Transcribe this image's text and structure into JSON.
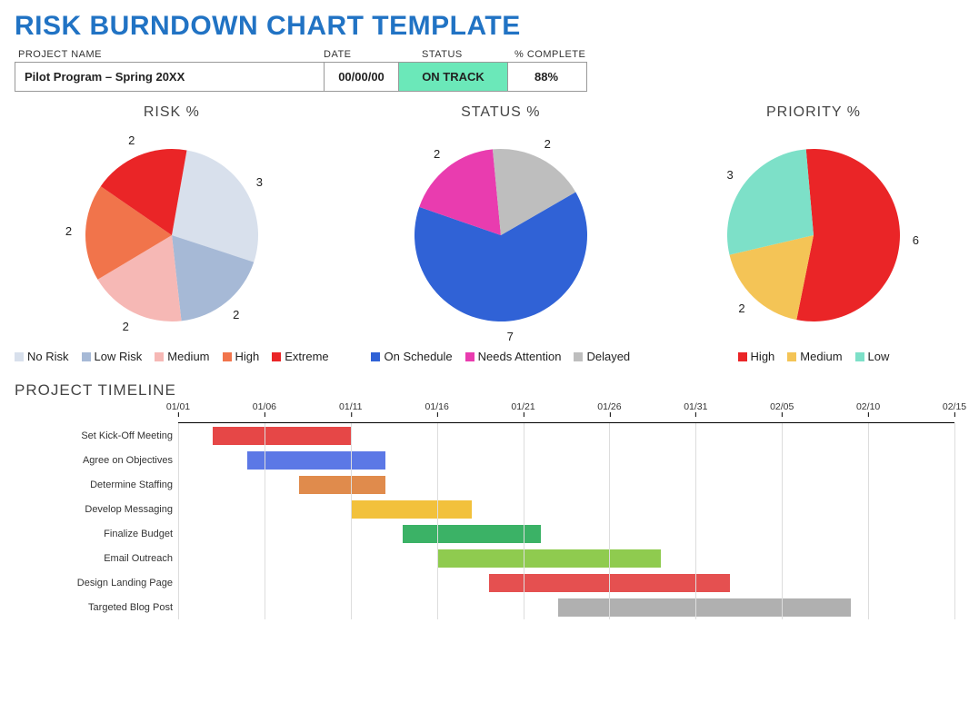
{
  "title": "RISK BURNDOWN CHART TEMPLATE",
  "meta": {
    "headers": {
      "name": "PROJECT NAME",
      "date": "DATE",
      "status": "STATUS",
      "complete": "% COMPLETE"
    },
    "name": "Pilot Program – Spring 20XX",
    "date": "00/00/00",
    "status": "ON TRACK",
    "complete": "88%",
    "status_bg": "#6BE8B9"
  },
  "charts": {
    "risk": {
      "title": "RISK %"
    },
    "status": {
      "title": "STATUS %"
    },
    "priority": {
      "title": "PRIORITY %"
    }
  },
  "legends": {
    "risk": [
      {
        "label": "No Risk",
        "color": "#D8E0EC"
      },
      {
        "label": "Low Risk",
        "color": "#A6B9D6"
      },
      {
        "label": "Medium",
        "color": "#F6B8B5"
      },
      {
        "label": "High",
        "color": "#F1744B"
      },
      {
        "label": "Extreme",
        "color": "#EA2527"
      }
    ],
    "status": [
      {
        "label": "On Schedule",
        "color": "#3062D6"
      },
      {
        "label": "Needs Attention",
        "color": "#E93CAF"
      },
      {
        "label": "Delayed",
        "color": "#BEBEBE"
      }
    ],
    "priority": [
      {
        "label": "High",
        "color": "#EA2527"
      },
      {
        "label": "Medium",
        "color": "#F4C456"
      },
      {
        "label": "Low",
        "color": "#7DE0C8"
      }
    ]
  },
  "timeline": {
    "title": "PROJECT TIMELINE",
    "ticks": [
      "01/01",
      "01/06",
      "01/11",
      "01/16",
      "01/21",
      "01/26",
      "01/31",
      "02/05",
      "02/10",
      "02/15"
    ],
    "tasks": [
      {
        "name": "Set Kick-Off Meeting",
        "start": 2,
        "dur": 8,
        "color": "#E64747"
      },
      {
        "name": "Agree on Objectives",
        "start": 4,
        "dur": 8,
        "color": "#5C78E6"
      },
      {
        "name": "Determine Staffing",
        "start": 7,
        "dur": 5,
        "color": "#E08B4C"
      },
      {
        "name": "Develop Messaging",
        "start": 10,
        "dur": 7,
        "color": "#F2C13C"
      },
      {
        "name": "Finalize Budget",
        "start": 13,
        "dur": 8,
        "color": "#3BB266"
      },
      {
        "name": "Email Outreach",
        "start": 15,
        "dur": 13,
        "color": "#8FCB4F"
      },
      {
        "name": "Design Landing Page",
        "start": 18,
        "dur": 14,
        "color": "#E55050"
      },
      {
        "name": "Targeted Blog Post",
        "start": 22,
        "dur": 17,
        "color": "#B0B0B0"
      }
    ]
  },
  "chart_data": [
    {
      "type": "pie",
      "title": "RISK %",
      "series": [
        {
          "name": "No Risk",
          "value": 3,
          "color": "#D8E0EC"
        },
        {
          "name": "Low Risk",
          "value": 2,
          "color": "#A6B9D6"
        },
        {
          "name": "Medium",
          "value": 2,
          "color": "#F6B8B5"
        },
        {
          "name": "High",
          "value": 2,
          "color": "#F1744B"
        },
        {
          "name": "Extreme",
          "value": 2,
          "color": "#EA2527"
        }
      ]
    },
    {
      "type": "pie",
      "title": "STATUS %",
      "series": [
        {
          "name": "On Schedule",
          "value": 7,
          "color": "#3062D6"
        },
        {
          "name": "Needs Attention",
          "value": 2,
          "color": "#E93CAF"
        },
        {
          "name": "Delayed",
          "value": 2,
          "color": "#BEBEBE"
        }
      ]
    },
    {
      "type": "pie",
      "title": "PRIORITY %",
      "series": [
        {
          "name": "High",
          "value": 6,
          "color": "#EA2527"
        },
        {
          "name": "Medium",
          "value": 2,
          "color": "#F4C456"
        },
        {
          "name": "Low",
          "value": 3,
          "color": "#7DE0C8"
        }
      ]
    },
    {
      "type": "gantt",
      "title": "PROJECT TIMELINE",
      "x_ticks": [
        "01/01",
        "01/06",
        "01/11",
        "01/16",
        "01/21",
        "01/26",
        "01/31",
        "02/05",
        "02/10",
        "02/15"
      ],
      "x_range_days": [
        0,
        45
      ],
      "tasks": [
        {
          "name": "Set Kick-Off Meeting",
          "start_day": 2,
          "duration_days": 8,
          "color": "#E64747"
        },
        {
          "name": "Agree on Objectives",
          "start_day": 4,
          "duration_days": 8,
          "color": "#5C78E6"
        },
        {
          "name": "Determine Staffing",
          "start_day": 7,
          "duration_days": 5,
          "color": "#E08B4C"
        },
        {
          "name": "Develop Messaging",
          "start_day": 10,
          "duration_days": 7,
          "color": "#F2C13C"
        },
        {
          "name": "Finalize Budget",
          "start_day": 13,
          "duration_days": 8,
          "color": "#3BB266"
        },
        {
          "name": "Email Outreach",
          "start_day": 15,
          "duration_days": 13,
          "color": "#8FCB4F"
        },
        {
          "name": "Design Landing Page",
          "start_day": 18,
          "duration_days": 14,
          "color": "#E55050"
        },
        {
          "name": "Targeted Blog Post",
          "start_day": 22,
          "duration_days": 17,
          "color": "#B0B0B0"
        }
      ]
    }
  ]
}
